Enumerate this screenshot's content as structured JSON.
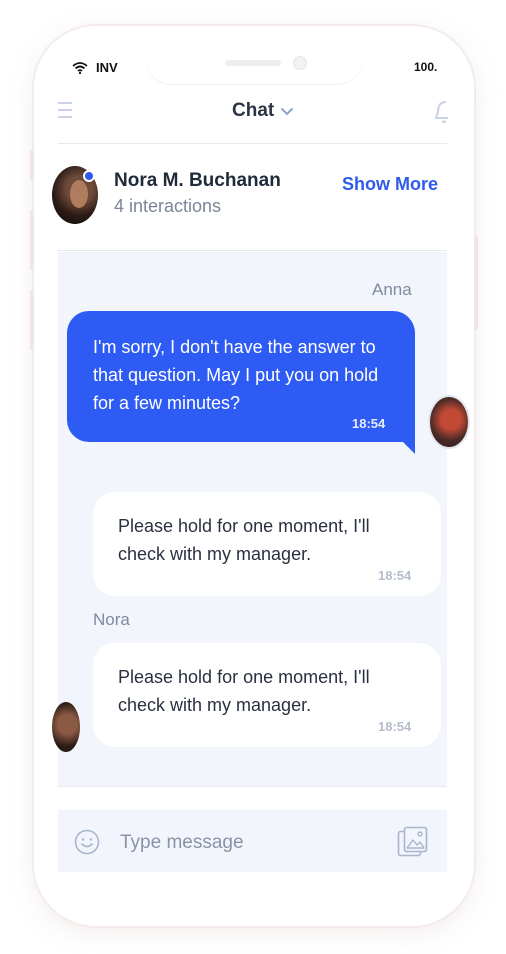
{
  "status_bar": {
    "carrier": "INV",
    "battery": "100."
  },
  "header": {
    "title": "Chat"
  },
  "contact": {
    "name": "Nora M. Buchanan",
    "interactions": "4 interactions",
    "show_more": "Show More"
  },
  "messages": [
    {
      "sender": "Anna",
      "text": "I'm sorry, I don't have the answer to that question. May I put you on hold for a few minutes?",
      "time": "18:54"
    },
    {
      "sender": "",
      "text": "Please hold for one moment, I'll check with my manager.",
      "time": "18:54"
    },
    {
      "sender": "Nora",
      "text": "Please hold for one moment, I'll check with my manager.",
      "time": "18:54"
    }
  ],
  "composer": {
    "placeholder": "Type message"
  },
  "icons": [
    "wifi-icon",
    "menu-icon",
    "chevron-down-icon",
    "bell-icon",
    "emoji-icon",
    "image-attach-icon"
  ],
  "colors": {
    "accent": "#2f5bf5",
    "chat_bg": "#f2f5fb",
    "text_dark": "#2a3040",
    "muted": "#7f8aa0"
  }
}
